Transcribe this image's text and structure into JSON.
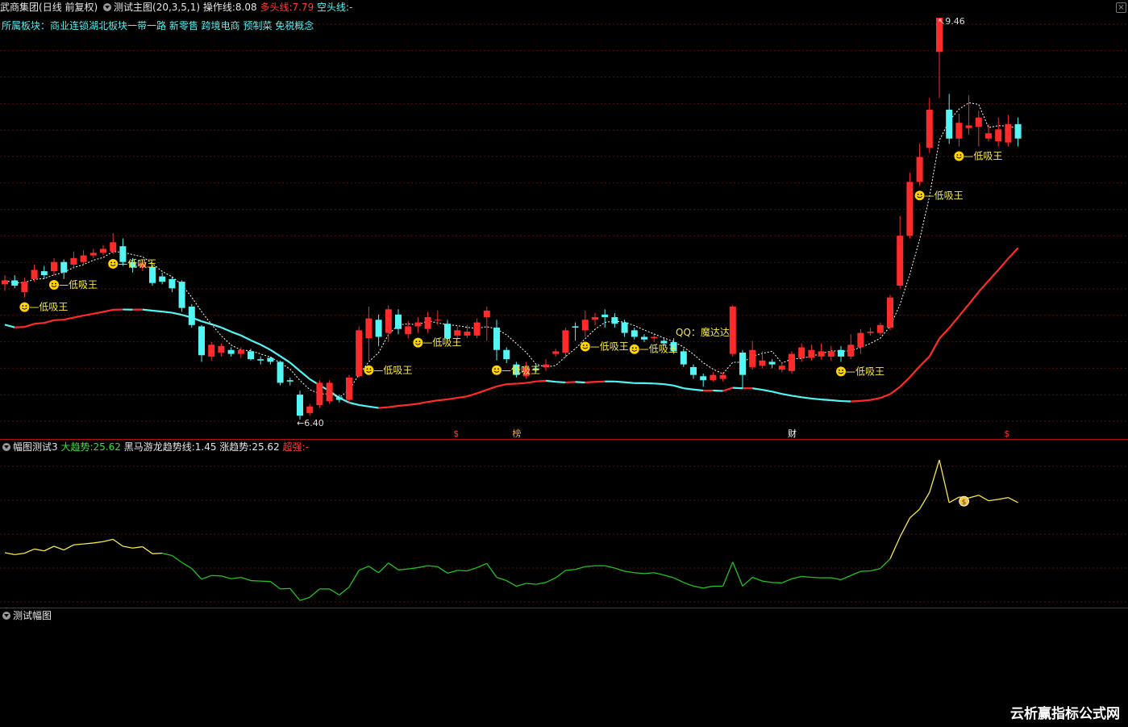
{
  "main_header": {
    "stock": "武商集团",
    "mode": "(日线 前复权)",
    "indicator": "测试主图(20,3,5,1)",
    "op_label": "操作线:",
    "op_value": "8.08",
    "long_label": "多头线:",
    "long_value": "7.79",
    "short_label": "空头线:",
    "short_value": "-"
  },
  "sector": "所属板块：商业连锁湖北板块一带一路 新零售 跨境电商 预制菜 免税概念",
  "annotations": {
    "high_price": "9.46",
    "low_price": "6.40",
    "qq_text": "QQ：魔达达",
    "signal_label": "低吸王",
    "event_markers": [
      "$",
      "榜",
      "财",
      "$"
    ]
  },
  "sub_header": {
    "name": "幅图测试3",
    "trend_label": "大趋势:",
    "trend_value": "25.62",
    "horse_label": "黑马游龙趋势线:",
    "horse_value": "1.45",
    "rise_label": "涨趋势:",
    "rise_value": "25.62",
    "strong_label": "超强:",
    "strong_value": "-"
  },
  "third_header": {
    "name": "测试幅图"
  },
  "watermark": "云析赢指标公式网",
  "colors": {
    "up": "#ff2b2b",
    "down": "#54f5f5",
    "trend_yellow": "#f5e94a",
    "trend_green": "#21c421",
    "separator": "#b10f0f"
  },
  "chart_data": {
    "type": "candlestick",
    "symbol": "武商集团",
    "price_extremes": {
      "high": 9.46,
      "low": 6.4
    },
    "candles": [
      {
        "o": 7.43,
        "c": 7.46,
        "h": 7.5,
        "l": 7.38
      },
      {
        "o": 7.46,
        "c": 7.42,
        "h": 7.5,
        "l": 7.4
      },
      {
        "o": 7.37,
        "c": 7.45,
        "h": 7.48,
        "l": 7.33
      },
      {
        "o": 7.47,
        "c": 7.54,
        "h": 7.58,
        "l": 7.45
      },
      {
        "o": 7.53,
        "c": 7.5,
        "h": 7.57,
        "l": 7.47
      },
      {
        "o": 7.53,
        "c": 7.6,
        "h": 7.63,
        "l": 7.5
      },
      {
        "o": 7.6,
        "c": 7.52,
        "h": 7.62,
        "l": 7.47
      },
      {
        "o": 7.58,
        "c": 7.63,
        "h": 7.68,
        "l": 7.55
      },
      {
        "o": 7.6,
        "c": 7.65,
        "h": 7.69,
        "l": 7.58
      },
      {
        "o": 7.65,
        "c": 7.67,
        "h": 7.7,
        "l": 7.63
      },
      {
        "o": 7.67,
        "c": 7.7,
        "h": 7.73,
        "l": 7.65
      },
      {
        "o": 7.68,
        "c": 7.75,
        "h": 7.82,
        "l": 7.66
      },
      {
        "o": 7.72,
        "c": 7.6,
        "h": 7.78,
        "l": 7.57
      },
      {
        "o": 7.6,
        "c": 7.56,
        "h": 7.63,
        "l": 7.52
      },
      {
        "o": 7.56,
        "c": 7.59,
        "h": 7.61,
        "l": 7.53
      },
      {
        "o": 7.56,
        "c": 7.44,
        "h": 7.58,
        "l": 7.42
      },
      {
        "o": 7.49,
        "c": 7.45,
        "h": 7.52,
        "l": 7.43
      },
      {
        "o": 7.47,
        "c": 7.4,
        "h": 7.49,
        "l": 7.37
      },
      {
        "o": 7.45,
        "c": 7.25,
        "h": 7.46,
        "l": 7.22
      },
      {
        "o": 7.26,
        "c": 7.12,
        "h": 7.28,
        "l": 7.1
      },
      {
        "o": 7.11,
        "c": 6.89,
        "h": 7.12,
        "l": 6.84
      },
      {
        "o": 6.88,
        "c": 6.97,
        "h": 6.99,
        "l": 6.85
      },
      {
        "o": 6.91,
        "c": 6.96,
        "h": 6.98,
        "l": 6.88
      },
      {
        "o": 6.93,
        "c": 6.9,
        "h": 6.95,
        "l": 6.88
      },
      {
        "o": 6.9,
        "c": 6.93,
        "h": 6.95,
        "l": 6.87
      },
      {
        "o": 6.92,
        "c": 6.86,
        "h": 6.94,
        "l": 6.85
      },
      {
        "o": 6.86,
        "c": 6.85,
        "h": 6.88,
        "l": 6.82
      },
      {
        "o": 6.87,
        "c": 6.84,
        "h": 6.88,
        "l": 6.82
      },
      {
        "o": 6.84,
        "c": 6.68,
        "h": 6.85,
        "l": 6.66
      },
      {
        "o": 6.7,
        "c": 6.69,
        "h": 6.72,
        "l": 6.66
      },
      {
        "o": 6.59,
        "c": 6.43,
        "h": 6.62,
        "l": 6.4
      },
      {
        "o": 6.45,
        "c": 6.5,
        "h": 6.52,
        "l": 6.43
      },
      {
        "o": 6.51,
        "c": 6.68,
        "h": 6.7,
        "l": 6.49
      },
      {
        "o": 6.54,
        "c": 6.68,
        "h": 6.7,
        "l": 6.52
      },
      {
        "o": 6.57,
        "c": 6.55,
        "h": 6.59,
        "l": 6.53
      },
      {
        "o": 6.55,
        "c": 6.72,
        "h": 6.74,
        "l": 6.52
      },
      {
        "o": 6.73,
        "c": 7.08,
        "h": 7.11,
        "l": 6.72
      },
      {
        "o": 7.02,
        "c": 7.17,
        "h": 7.26,
        "l": 6.85
      },
      {
        "o": 7.16,
        "c": 7.03,
        "h": 7.2,
        "l": 6.96
      },
      {
        "o": 7.06,
        "c": 7.24,
        "h": 7.27,
        "l": 6.99
      },
      {
        "o": 7.2,
        "c": 7.09,
        "h": 7.24,
        "l": 7.05
      },
      {
        "o": 7.05,
        "c": 7.11,
        "h": 7.15,
        "l": 7.02
      },
      {
        "o": 7.11,
        "c": 7.14,
        "h": 7.18,
        "l": 7.06
      },
      {
        "o": 7.09,
        "c": 7.18,
        "h": 7.22,
        "l": 7.06
      },
      {
        "o": 7.16,
        "c": 7.16,
        "h": 7.23,
        "l": 7.12
      },
      {
        "o": 7.13,
        "c": 7.02,
        "h": 7.16,
        "l": 7.0
      },
      {
        "o": 7.04,
        "c": 7.08,
        "h": 7.11,
        "l": 7.01
      },
      {
        "o": 7.04,
        "c": 7.07,
        "h": 7.12,
        "l": 7.02
      },
      {
        "o": 7.04,
        "c": 7.14,
        "h": 7.17,
        "l": 7.02
      },
      {
        "o": 7.18,
        "c": 7.23,
        "h": 7.26,
        "l": 7.0
      },
      {
        "o": 7.1,
        "c": 6.93,
        "h": 7.16,
        "l": 6.85
      },
      {
        "o": 6.93,
        "c": 6.86,
        "h": 6.95,
        "l": 6.83
      },
      {
        "o": 6.82,
        "c": 6.74,
        "h": 6.84,
        "l": 6.72
      },
      {
        "o": 6.73,
        "c": 6.8,
        "h": 6.84,
        "l": 6.71
      },
      {
        "o": 6.79,
        "c": 6.78,
        "h": 6.82,
        "l": 6.76
      },
      {
        "o": 6.8,
        "c": 6.82,
        "h": 6.86,
        "l": 6.77
      },
      {
        "o": 6.9,
        "c": 6.92,
        "h": 6.94,
        "l": 6.88
      },
      {
        "o": 6.91,
        "c": 7.08,
        "h": 7.1,
        "l": 6.87
      },
      {
        "o": 7.11,
        "c": 7.1,
        "h": 7.14,
        "l": 7.0
      },
      {
        "o": 7.08,
        "c": 7.16,
        "h": 7.23,
        "l": 7.03
      },
      {
        "o": 7.16,
        "c": 7.18,
        "h": 7.21,
        "l": 7.12
      },
      {
        "o": 7.2,
        "c": 7.18,
        "h": 7.24,
        "l": 7.1
      },
      {
        "o": 7.18,
        "c": 7.13,
        "h": 7.21,
        "l": 7.1
      },
      {
        "o": 7.14,
        "c": 7.06,
        "h": 7.16,
        "l": 7.03
      },
      {
        "o": 7.08,
        "c": 7.03,
        "h": 7.1,
        "l": 7.01
      },
      {
        "o": 7.03,
        "c": 7.01,
        "h": 7.05,
        "l": 6.99
      },
      {
        "o": 7.02,
        "c": 7.03,
        "h": 7.05,
        "l": 6.99
      },
      {
        "o": 7.0,
        "c": 6.98,
        "h": 7.02,
        "l": 6.96
      },
      {
        "o": 6.99,
        "c": 6.92,
        "h": 7.02,
        "l": 6.9
      },
      {
        "o": 6.92,
        "c": 6.82,
        "h": 6.94,
        "l": 6.8
      },
      {
        "o": 6.8,
        "c": 6.74,
        "h": 6.82,
        "l": 6.71
      },
      {
        "o": 6.73,
        "c": 6.7,
        "h": 6.75,
        "l": 6.65
      },
      {
        "o": 6.7,
        "c": 6.74,
        "h": 6.76,
        "l": 6.69
      },
      {
        "o": 6.71,
        "c": 6.74,
        "h": 6.76,
        "l": 6.69
      },
      {
        "o": 6.9,
        "c": 7.26,
        "h": 7.27,
        "l": 6.88
      },
      {
        "o": 6.91,
        "c": 6.74,
        "h": 6.93,
        "l": 6.64
      },
      {
        "o": 6.8,
        "c": 6.93,
        "h": 7.0,
        "l": 6.78
      },
      {
        "o": 6.81,
        "c": 6.85,
        "h": 6.92,
        "l": 6.79
      },
      {
        "o": 6.84,
        "c": 6.82,
        "h": 6.86,
        "l": 6.79
      },
      {
        "o": 6.78,
        "c": 6.81,
        "h": 6.84,
        "l": 6.76
      },
      {
        "o": 6.77,
        "c": 6.9,
        "h": 6.92,
        "l": 6.75
      },
      {
        "o": 6.87,
        "c": 6.95,
        "h": 6.98,
        "l": 6.84
      },
      {
        "o": 6.87,
        "c": 6.93,
        "h": 6.97,
        "l": 6.85
      },
      {
        "o": 6.88,
        "c": 6.92,
        "h": 6.98,
        "l": 6.86
      },
      {
        "o": 6.88,
        "c": 6.92,
        "h": 6.96,
        "l": 6.85
      },
      {
        "o": 6.93,
        "c": 6.88,
        "h": 6.96,
        "l": 6.84
      },
      {
        "o": 6.88,
        "c": 6.97,
        "h": 7.05,
        "l": 6.86
      },
      {
        "o": 6.95,
        "c": 7.06,
        "h": 7.09,
        "l": 6.9
      },
      {
        "o": 7.06,
        "c": 7.07,
        "h": 7.1,
        "l": 7.04
      },
      {
        "o": 7.06,
        "c": 7.12,
        "h": 7.14,
        "l": 7.04
      },
      {
        "o": 7.1,
        "c": 7.33,
        "h": 7.35,
        "l": 7.08
      },
      {
        "o": 7.42,
        "c": 7.8,
        "h": 7.95,
        "l": 7.4
      },
      {
        "o": 7.8,
        "c": 8.21,
        "h": 8.28,
        "l": 7.78
      },
      {
        "o": 8.21,
        "c": 8.4,
        "h": 8.5,
        "l": 8.18
      },
      {
        "o": 8.47,
        "c": 8.76,
        "h": 8.85,
        "l": 8.43
      },
      {
        "o": 9.2,
        "c": 9.46,
        "h": 9.46,
        "l": 8.85
      },
      {
        "o": 8.76,
        "c": 8.54,
        "h": 8.88,
        "l": 8.5
      },
      {
        "o": 8.54,
        "c": 8.66,
        "h": 8.73,
        "l": 8.48
      },
      {
        "o": 8.62,
        "c": 8.64,
        "h": 8.87,
        "l": 8.57
      },
      {
        "o": 8.63,
        "c": 8.7,
        "h": 8.75,
        "l": 8.48
      },
      {
        "o": 8.54,
        "c": 8.58,
        "h": 8.65,
        "l": 8.52
      },
      {
        "o": 8.52,
        "c": 8.61,
        "h": 8.7,
        "l": 8.48
      },
      {
        "o": 8.51,
        "c": 8.65,
        "h": 8.72,
        "l": 8.48
      },
      {
        "o": 8.65,
        "c": 8.54,
        "h": 8.7,
        "l": 8.48
      }
    ],
    "sub_series": {
      "name": "大趋势",
      "last": 25.62
    }
  }
}
